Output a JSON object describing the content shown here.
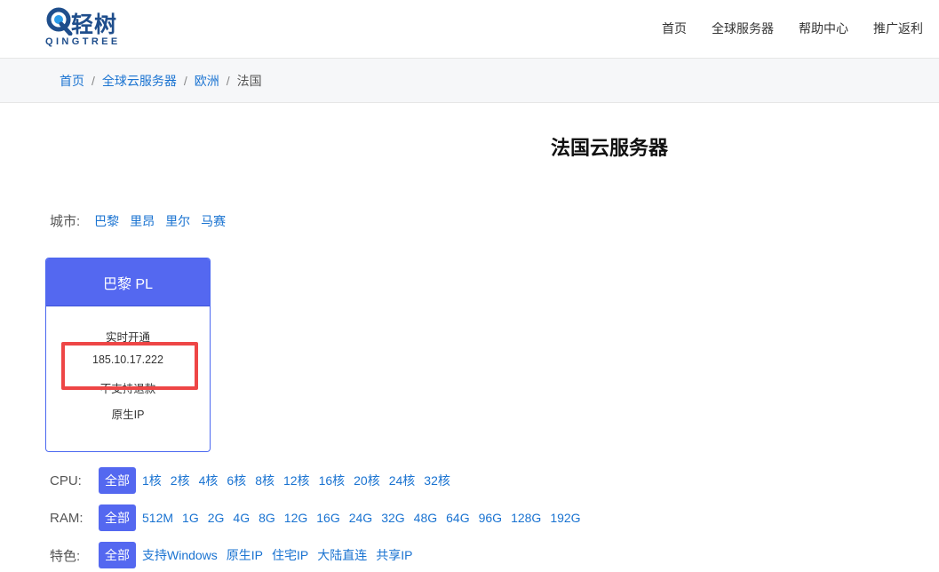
{
  "header": {
    "logo_cn": "轻树",
    "logo_en": "QINGTREE",
    "nav": [
      "首页",
      "全球服务器",
      "帮助中心",
      "推广返利"
    ]
  },
  "breadcrumb": {
    "items": [
      "首页",
      "全球云服务器",
      "欧洲"
    ],
    "current": "法国",
    "separator": "/"
  },
  "page_title": "法国云服务器",
  "city_filter": {
    "label": "城市:",
    "cities": [
      "巴黎",
      "里昂",
      "里尔",
      "马赛"
    ]
  },
  "server_card": {
    "title": "巴黎 PL",
    "lines": [
      "实时开通",
      "185.10.17.222",
      "不支持退款",
      "原生IP"
    ]
  },
  "filters": {
    "cpu": {
      "label": "CPU:",
      "all": "全部",
      "options": [
        "1核",
        "2核",
        "4核",
        "6核",
        "8核",
        "12核",
        "16核",
        "20核",
        "24核",
        "32核"
      ]
    },
    "ram": {
      "label": "RAM:",
      "all": "全部",
      "options": [
        "512M",
        "1G",
        "2G",
        "4G",
        "8G",
        "12G",
        "16G",
        "24G",
        "32G",
        "48G",
        "64G",
        "96G",
        "128G",
        "192G"
      ]
    },
    "feature": {
      "label": "特色:",
      "all": "全部",
      "options": [
        "支持Windows",
        "原生IP",
        "住宅IP",
        "大陆直连",
        "共享IP"
      ]
    }
  },
  "colors": {
    "accent": "#5468f0",
    "link": "#1a73d1",
    "highlight": "#ee4646"
  }
}
